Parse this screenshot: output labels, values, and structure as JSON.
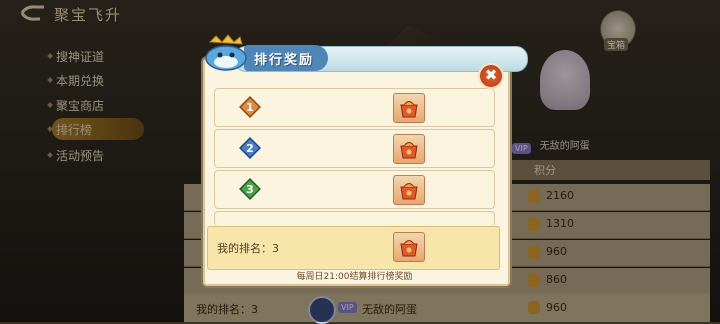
{
  "header": {
    "title": "聚宝飞升",
    "gift_label": "宝箱"
  },
  "sidebar": {
    "items": [
      {
        "label": "搜神证道"
      },
      {
        "label": "本期兑换"
      },
      {
        "label": "聚宝商店"
      },
      {
        "label": "排行榜"
      },
      {
        "label": "活动预告"
      }
    ]
  },
  "leaderboard": {
    "score_header": "积分",
    "player_name": "无敌的阿蛋",
    "player_badge": "VIP",
    "scores": [
      "2160",
      "1310",
      "960",
      "860"
    ],
    "my_rank": "我的排名：3",
    "my_score": "960"
  },
  "modal": {
    "title": "排行奖励",
    "close_symbol": "✖",
    "rows": [
      {
        "rank": "1",
        "color": "#e38a3a"
      },
      {
        "rank": "2",
        "color": "#4a7fd0"
      },
      {
        "rank": "3",
        "color": "#4aa348"
      }
    ],
    "my_rank": "我的排名：3",
    "footnote": "每周日21:00结算排行榜奖励"
  }
}
